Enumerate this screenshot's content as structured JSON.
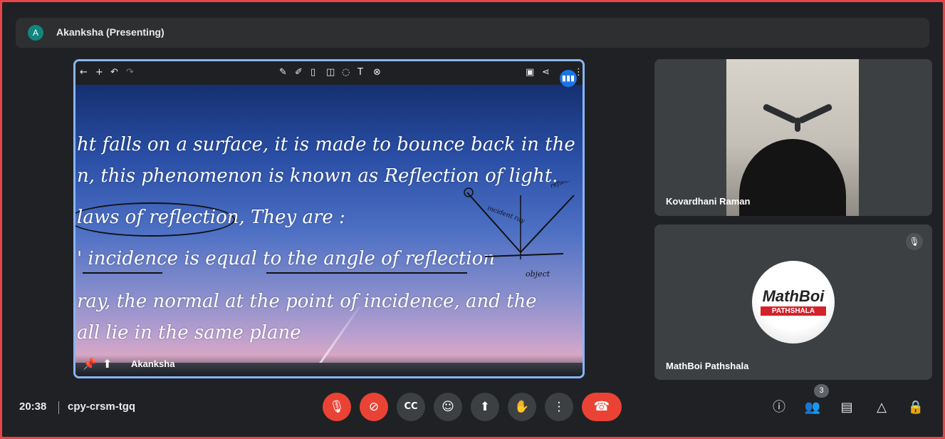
{
  "header": {
    "avatar_letter": "A",
    "presenting_label": "Akanksha (Presenting)"
  },
  "presentation": {
    "lines": [
      "ht falls on a surface, it is made to bounce back in the",
      "n, this phenomenon is known as Reflection of light.",
      "laws of reflection, They are :",
      "' incidence is equal to the angle of reflection",
      "ray, the normal at the point of  incidence, and the",
      "all lie in the same plane"
    ],
    "presenter_name": "Akanksha",
    "sketch_labels": [
      "incident ray",
      "reflected ray",
      "object"
    ]
  },
  "participants": [
    {
      "name": "Kovardhani Raman"
    },
    {
      "name": "MathBoi Pathshala",
      "logo_title": "MathBoi",
      "logo_subtitle": "PATHSHALA",
      "muted": true
    }
  ],
  "footer": {
    "time": "20:38",
    "meeting_code": "cpy-crsm-tgq",
    "people_count": "3"
  },
  "colors": {
    "accent": "#8ab4f8",
    "danger": "#ea4335",
    "background": "#202124"
  }
}
